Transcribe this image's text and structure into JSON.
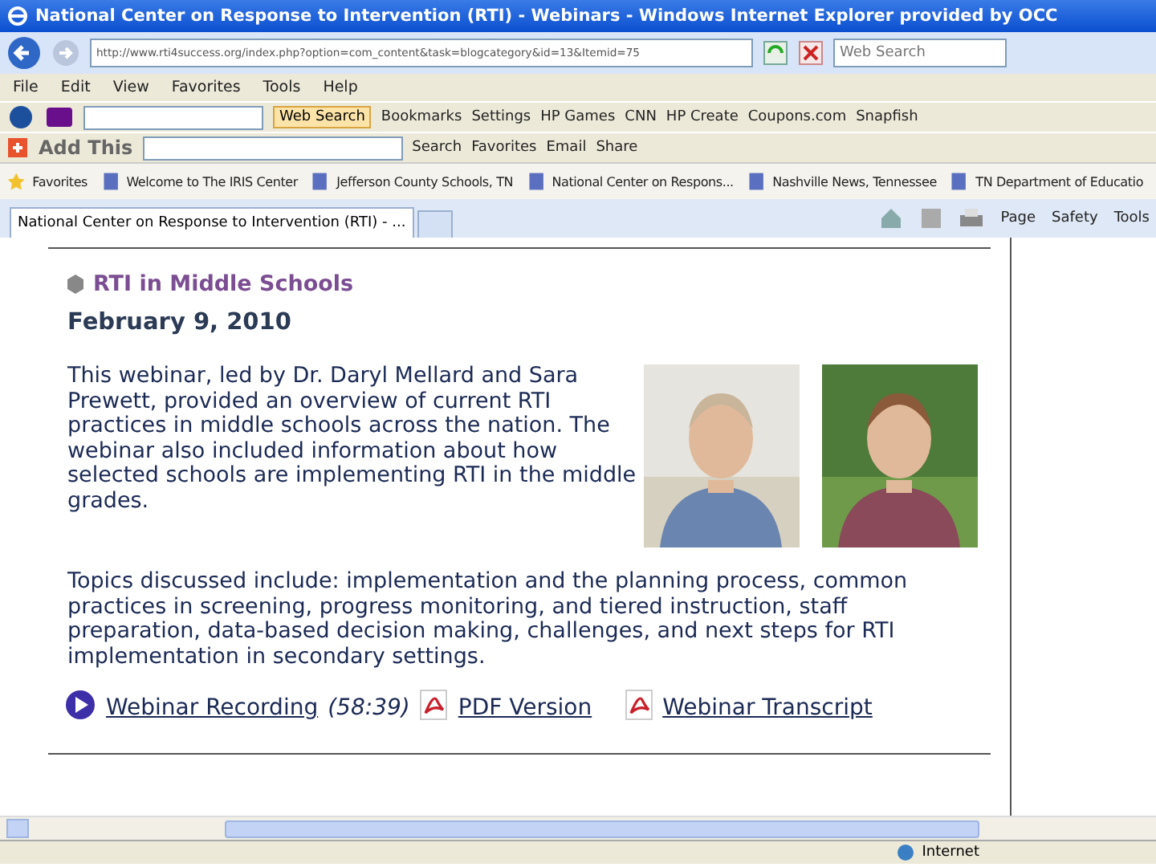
{
  "window": {
    "title": "National Center on Response to Intervention (RTI) - Webinars - Windows Internet Explorer provided by OCC"
  },
  "address_bar": {
    "url": "http://www.rti4success.org/index.php?option=com_content&task=blogcategory&id=13&Itemid=75",
    "search_placeholder": "Web Search"
  },
  "menu": [
    "File",
    "Edit",
    "View",
    "Favorites",
    "Tools",
    "Help"
  ],
  "toolbar_1": {
    "search_button": "Web Search",
    "items": [
      "Bookmarks",
      "Settings",
      "HP Games",
      "CNN",
      "HP Create",
      "Coupons.com",
      "Snapfish"
    ]
  },
  "toolbar_2": {
    "logo": "Add This",
    "items": [
      "Search",
      "Favorites",
      "Email",
      "Share"
    ]
  },
  "favorites_bar": {
    "label": "Favorites",
    "items": [
      "Welcome to The IRIS Center",
      "Jefferson County Schools, TN",
      "National Center on Respons...",
      "Nashville News, Tennessee",
      "TN Department of Educatio"
    ]
  },
  "tabs": [
    {
      "label": "National Center on Response to Intervention (RTI) - ...",
      "selected": true
    }
  ],
  "command_bar": [
    "Page",
    "Safety",
    "Tools"
  ],
  "article": {
    "heading": "RTI in Middle Schools",
    "date": "February 9, 2010",
    "summary": "This webinar, led by Dr. Daryl Mellard and Sara Prewett, provided an overview of current RTI practices in middle schools across the nation. The webinar also included information about how selected schools are implementing RTI in the middle grades.",
    "topics": "Topics discussed include: implementation and the planning process, common practices in screening, progress monitoring, and tiered instruction, staff preparation, data-based decision making, challenges, and next steps for RTI implementation in secondary settings.",
    "links": [
      {
        "kind": "video",
        "label": "Webinar Recording",
        "duration": "(58:39)"
      },
      {
        "kind": "pdf",
        "label": "PDF Version"
      },
      {
        "kind": "pdf",
        "label": "Webinar Transcript"
      }
    ]
  },
  "status_bar": {
    "zone": "Internet"
  }
}
